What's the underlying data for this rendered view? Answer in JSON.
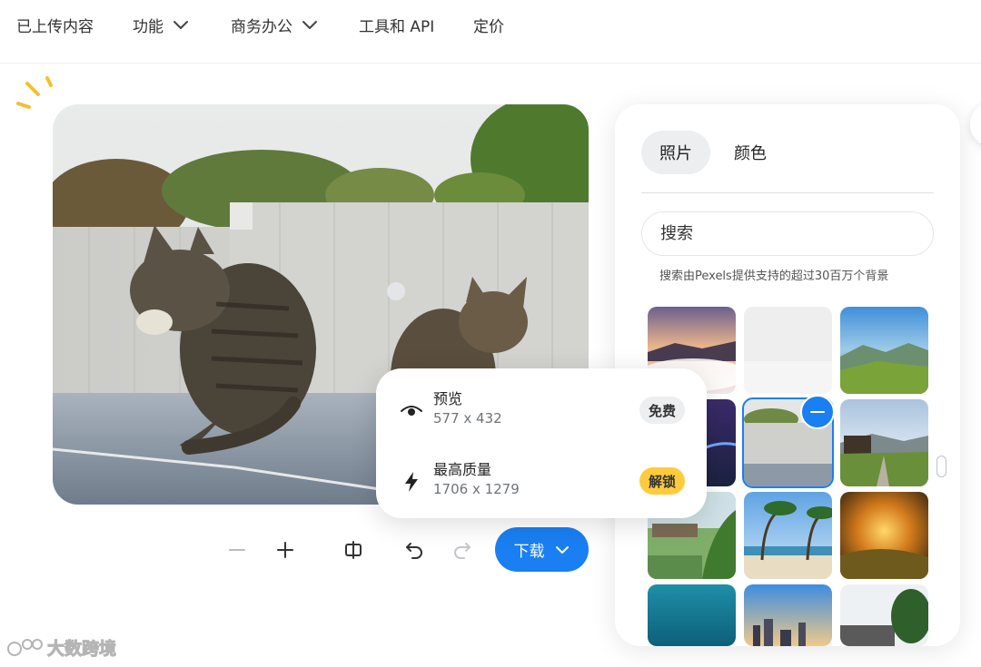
{
  "nav": {
    "items": [
      {
        "label": "已上传内容"
      },
      {
        "label": "功能"
      },
      {
        "label": "商务办公"
      },
      {
        "label": "工具和 API"
      },
      {
        "label": "定价"
      }
    ]
  },
  "popover": {
    "preview": {
      "title": "预览",
      "size": "577 x 432",
      "badge": "免费",
      "icon": "eye-icon"
    },
    "hq": {
      "title": "最高质量",
      "size": "1706 x 1279",
      "badge": "解锁",
      "icon": "bolt-icon"
    }
  },
  "toolbar": {
    "download_label": "下载"
  },
  "panel": {
    "tabs": [
      {
        "label": "照片"
      },
      {
        "label": "颜色"
      }
    ],
    "search_placeholder": "搜索",
    "search_note": "搜索由Pexels提供支持的超过30百万个背景"
  },
  "watermark": {
    "text": "大数跨境"
  },
  "colors": {
    "accent": "#1a7ff2",
    "unlock_badge": "#ffcb3d",
    "free_badge": "#eceef0"
  }
}
